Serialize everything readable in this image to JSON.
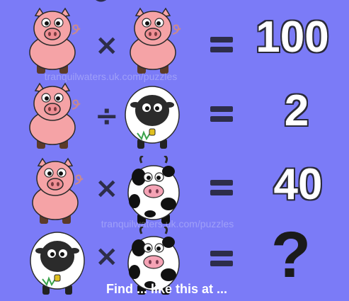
{
  "puzzle": {
    "rows": [
      {
        "left": "pig",
        "operator": "×",
        "right": "pig",
        "result": "100"
      },
      {
        "left": "pig",
        "operator": "÷",
        "right": "sheep",
        "result": "2"
      },
      {
        "left": "pig",
        "operator": "×",
        "right": "cow",
        "result": "40"
      },
      {
        "left": "sheep",
        "operator": "×",
        "right": "cow",
        "result": "?"
      }
    ],
    "watermark": "tranquilwaters.uk.com/puzzles",
    "footer_text": "Find ... like this at ...",
    "colors": {
      "background": "#7b7bf7",
      "pig": "#f5a3a6",
      "sheep_wool": "#ffffff",
      "sheep_face": "#2b2b2b",
      "cow_body": "#ffffff",
      "cow_spots": "#111111",
      "operator": "#2d2d4a"
    }
  }
}
